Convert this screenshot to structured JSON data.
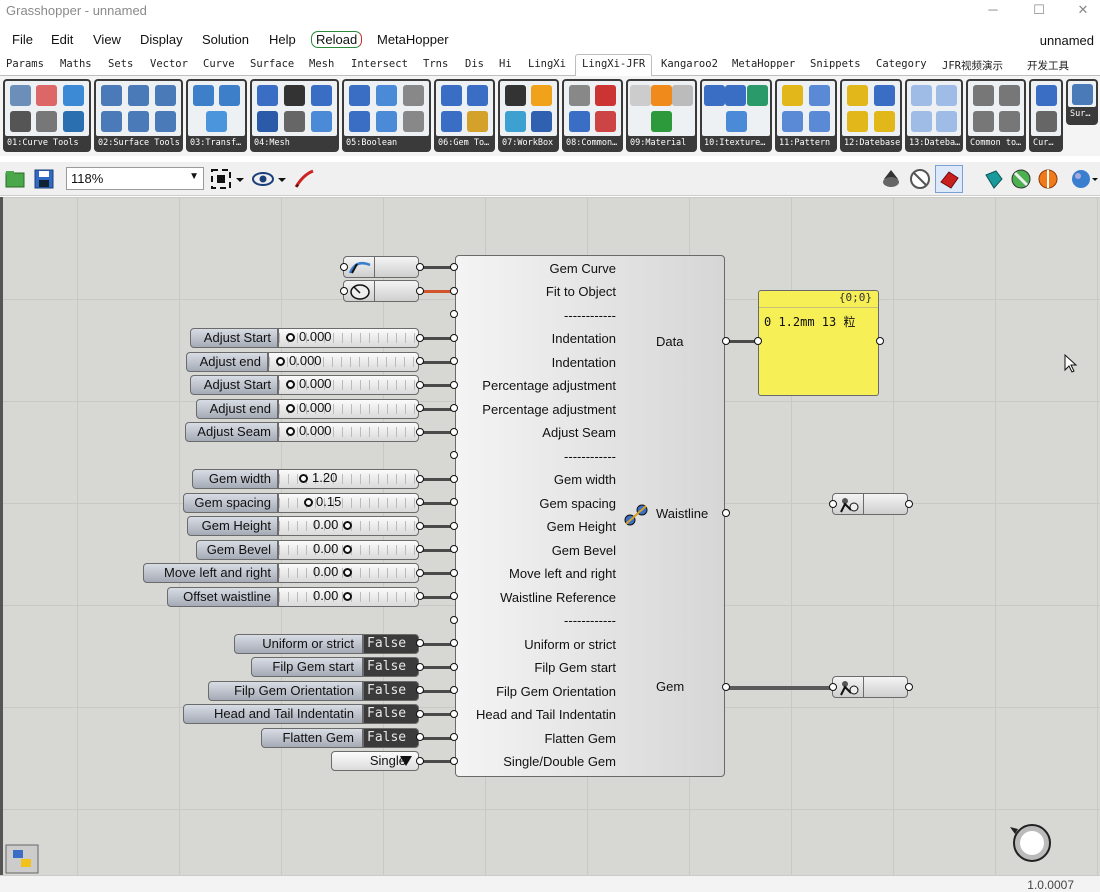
{
  "window": {
    "title": "Grasshopper - unnamed",
    "doc_name": "unnamed",
    "minimize": "─",
    "maximize": "☐",
    "close": "✕"
  },
  "menu": [
    "File",
    "Edit",
    "View",
    "Display",
    "Solution",
    "Help",
    "Reload",
    "MetaHopper"
  ],
  "tabs": [
    "Params",
    "Maths",
    "Sets",
    "Vector",
    "Curve",
    "Surface",
    "Mesh",
    "Intersect",
    "Trns",
    "Dis",
    "Hi",
    "LingXi",
    "LingXi-JFR",
    "Kangaroo2",
    "MetaHopper",
    "Snippets",
    "Category",
    "JFR视频演示",
    "开发工具"
  ],
  "active_tab": "LingXi-JFR",
  "ribbon_panels": [
    "01:Curve Tools",
    "02:Surface Tools",
    "03:Transf…",
    "04:Mesh",
    "05:Boolean",
    "06:Gem To…",
    "07:WorkBox",
    "08:Common…",
    "09:Material",
    "10:Itexture…",
    "11:Pattern",
    "12:Datebase",
    "13:Dateba…",
    "Common to…",
    "Cur…",
    "Sur…"
  ],
  "toolbar": {
    "zoom": "118%"
  },
  "canvas": {
    "sliders": [
      {
        "label": "Adjust Start",
        "value": "0.000"
      },
      {
        "label": "Adjust end",
        "value": "0.000"
      },
      {
        "label": "Adjust Start",
        "value": "0.000"
      },
      {
        "label": "Adjust end",
        "value": "0.000"
      },
      {
        "label": "Adjust Seam",
        "value": "0.000"
      },
      {
        "label": "Gem width",
        "value": "1.20"
      },
      {
        "label": "Gem spacing",
        "value": "0.15"
      },
      {
        "label": "Gem Height",
        "value": "0.00"
      },
      {
        "label": "Gem Bevel",
        "value": "0.00"
      },
      {
        "label": "Move left and right",
        "value": "0.00"
      },
      {
        "label": "Offset waistline",
        "value": "0.00"
      }
    ],
    "toggles": [
      {
        "label": "Uniform or strict",
        "value": "False"
      },
      {
        "label": "Filp Gem start",
        "value": "False"
      },
      {
        "label": "Filp Gem Orientation",
        "value": "False"
      },
      {
        "label": "Head and Tail Indentatin",
        "value": "False"
      },
      {
        "label": "Flatten Gem",
        "value": "False"
      }
    ],
    "value_list": {
      "value": "Single"
    },
    "component": {
      "inputs": [
        "Gem Curve",
        "Fit to Object",
        "------------",
        "Indentation",
        "Indentation",
        "Percentage adjustment",
        "Percentage adjustment",
        "Adjust Seam",
        "------------",
        "Gem width",
        "Gem spacing",
        "Gem Height",
        "Gem Bevel",
        "Move left and right",
        "Waistline Reference",
        "------------",
        "Uniform or strict",
        "Filp Gem start",
        "Filp Gem Orientation",
        "Head and Tail Indentatin",
        "Flatten Gem",
        "Single/Double Gem"
      ],
      "outputs": [
        "Data",
        "Waistline",
        "Gem"
      ]
    },
    "panel": {
      "header": "{0;0}",
      "content": "0 1.2mm 13 粒"
    }
  },
  "status": {
    "version": "1.0.0007"
  }
}
